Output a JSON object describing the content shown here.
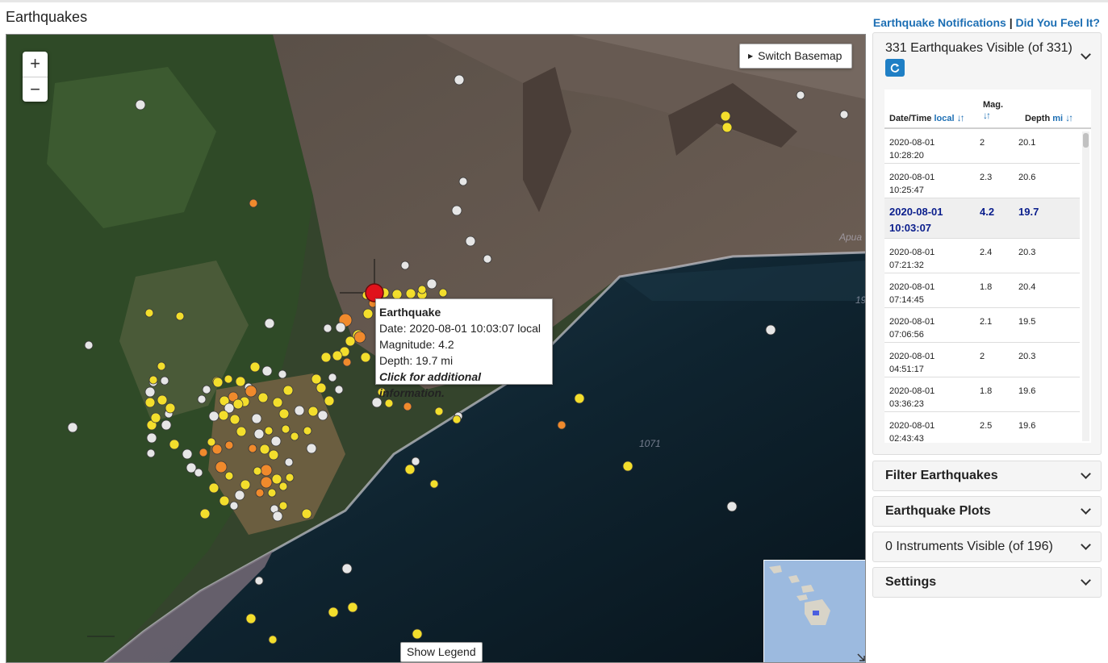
{
  "page": {
    "title": "Earthquakes",
    "links": {
      "notifications": "Earthquake Notifications",
      "separator": "|",
      "feel_it": "Did You Feel It?"
    }
  },
  "map": {
    "zoom_in": "+",
    "zoom_out": "−",
    "switch_basemap": "Switch Basemap",
    "show_legend": "Show Legend",
    "labels": {
      "depth_contour_1": "1071",
      "depth_contour_2": "19",
      "place_fragment": "Apua"
    },
    "popup": {
      "title": "Earthquake",
      "date": "Date: 2020-08-01 10:03:07 local",
      "magnitude": "Magnitude: 4.2",
      "depth": "Depth: 19.7 mi",
      "more": "Click for additional information."
    },
    "marker_colors": {
      "past_hour": "#e0121b",
      "past_day": "#f08a2c",
      "past_week": "#f3de2c",
      "older": "#e6e6e6"
    }
  },
  "sidebar": {
    "earthquakes_panel": {
      "title": "331 Earthquakes Visible (of 331)",
      "columns": {
        "datetime": "Date/Time",
        "datetime_unit": "local",
        "mag": "Mag.",
        "depth": "Depth",
        "depth_unit": "mi"
      },
      "rows": [
        {
          "date": "2020-08-01",
          "time": "10:28:20",
          "mag": "2",
          "depth": "20.1",
          "selected": false
        },
        {
          "date": "2020-08-01",
          "time": "10:25:47",
          "mag": "2.3",
          "depth": "20.6",
          "selected": false
        },
        {
          "date": "2020-08-01",
          "time": "10:03:07",
          "mag": "4.2",
          "depth": "19.7",
          "selected": true
        },
        {
          "date": "2020-08-01",
          "time": "07:21:32",
          "mag": "2.4",
          "depth": "20.3",
          "selected": false
        },
        {
          "date": "2020-08-01",
          "time": "07:14:45",
          "mag": "1.8",
          "depth": "20.4",
          "selected": false
        },
        {
          "date": "2020-08-01",
          "time": "07:06:56",
          "mag": "2.1",
          "depth": "19.5",
          "selected": false
        },
        {
          "date": "2020-08-01",
          "time": "04:51:17",
          "mag": "2",
          "depth": "20.3",
          "selected": false
        },
        {
          "date": "2020-08-01",
          "time": "03:36:23",
          "mag": "1.8",
          "depth": "19.6",
          "selected": false
        },
        {
          "date": "2020-08-01",
          "time": "02:43:43",
          "mag": "2.5",
          "depth": "19.6",
          "selected": false
        }
      ]
    },
    "filter_panel": "Filter Earthquakes",
    "plots_panel": "Earthquake Plots",
    "instruments_panel": "0 Instruments Visible (of 196)",
    "settings_panel": "Settings"
  }
}
